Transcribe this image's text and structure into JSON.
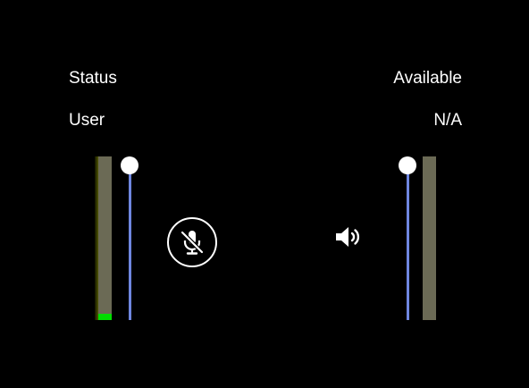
{
  "status": {
    "label": "Status",
    "value": "Available"
  },
  "user": {
    "label": "User",
    "value": "N/A"
  },
  "microphone": {
    "level_fraction": 0.04,
    "volume_fraction": 1.0,
    "muted": true,
    "mute_icon": "microphone-slash-icon"
  },
  "speaker": {
    "volume_fraction": 1.0,
    "icon": "speaker-volume-icon"
  },
  "colors": {
    "background": "#000000",
    "text": "#ffffff",
    "meter": "#6b6a55",
    "meter_level": "#00dd00",
    "slider_track": "#6f86e0",
    "slider_thumb": "#ffffff"
  }
}
